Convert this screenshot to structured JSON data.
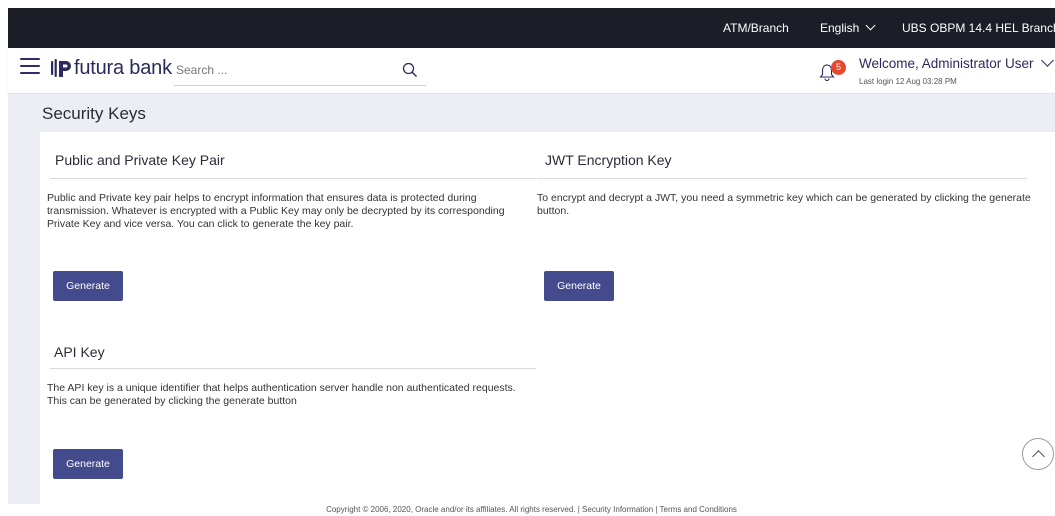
{
  "topbar": {
    "atm_branch": "ATM/Branch",
    "language": "English",
    "branch": "UBS OBPM 14.4 HEL Branch"
  },
  "header": {
    "logo_text": "futura bank",
    "search_placeholder": "Search ...",
    "notification_count": "5",
    "welcome": "Welcome, Administrator User",
    "last_login": "Last login 12 Aug 03:28 PM"
  },
  "page": {
    "title": "Security Keys"
  },
  "sections": {
    "key_pair": {
      "title": "Public and Private Key Pair",
      "description": "Public and Private key pair helps to encrypt information that ensures data is protected during transmission. Whatever is encrypted with a Public Key may only be decrypted by its corresponding Private Key and vice versa. You can click to generate the key pair.",
      "button": "Generate"
    },
    "jwt": {
      "title": "JWT Encryption Key",
      "description": "To encrypt and decrypt a JWT, you need a symmetric key which can be generated by clicking the generate button.",
      "button": "Generate"
    },
    "api": {
      "title": "API Key",
      "description": "The API key is a unique identifier that helps authentication server handle non authenticated requests. This can be generated by clicking the generate button",
      "button": "Generate"
    }
  },
  "footer": {
    "text": "Copyright © 2006, 2020, Oracle and/or its affiliates. All rights reserved. | Security Information | Terms and Conditions"
  },
  "colors": {
    "topbar_bg": "#1c1e27",
    "brand": "#2a2a5e",
    "button": "#444b8c",
    "badge": "#e8472d",
    "content_bg": "#eceef3"
  }
}
